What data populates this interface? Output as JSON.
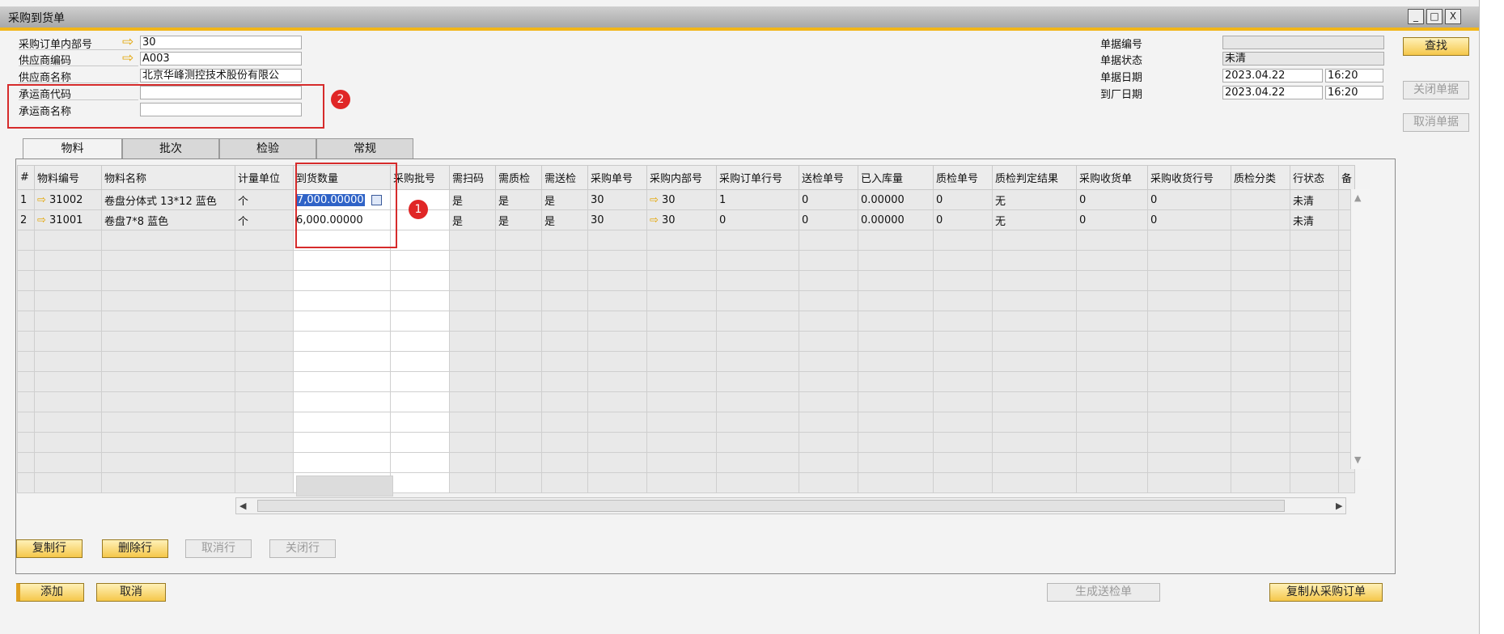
{
  "window": {
    "title": "采购到货单",
    "controls": [
      "_",
      "□",
      "X"
    ]
  },
  "header_left": {
    "po_internal_no": {
      "label": "采购订单内部号",
      "value": "30"
    },
    "vendor_code": {
      "label": "供应商编码",
      "value": "A003"
    },
    "vendor_name": {
      "label": "供应商名称",
      "value": "北京华峰测控技术股份有限公"
    },
    "carrier_code": {
      "label": "承运商代码",
      "value": ""
    },
    "carrier_name": {
      "label": "承运商名称",
      "value": ""
    }
  },
  "header_right": {
    "doc_no": {
      "label": "单据编号",
      "value": ""
    },
    "doc_status": {
      "label": "单据状态",
      "value": "未清"
    },
    "doc_date": {
      "label": "单据日期",
      "value": "2023.04.22",
      "time": "16:20"
    },
    "arrival_date": {
      "label": "到厂日期",
      "value": "2023.04.22",
      "time": "16:20"
    }
  },
  "side_buttons": {
    "find": "查找",
    "close_doc": "关闭单据",
    "cancel_doc": "取消单据"
  },
  "tabs": [
    {
      "label": "物料"
    },
    {
      "label": "批次"
    },
    {
      "label": "检验"
    },
    {
      "label": "常规"
    }
  ],
  "table": {
    "columns": [
      "#",
      "物料编号",
      "物料名称",
      "计量单位",
      "到货数量",
      "采购批号",
      "需扫码",
      "需质检",
      "需送检",
      "采购单号",
      "采购内部号",
      "采购订单行号",
      "送检单号",
      "已入库量",
      "质检单号",
      "质检判定结果",
      "采购收货单",
      "采购收货行号",
      "质检分类",
      "行状态",
      "备"
    ],
    "rows": [
      [
        "1",
        "31002",
        "卷盘分体式 13*12 蓝色",
        "个",
        "7,000.00000",
        "",
        "是",
        "是",
        "是",
        "30",
        "30",
        "1",
        "0",
        "0.00000",
        "0",
        "无",
        "0",
        "0",
        "",
        "未清",
        ""
      ],
      [
        "2",
        "31001",
        "卷盘7*8 蓝色",
        "个",
        "6,000.00000",
        "",
        "是",
        "是",
        "是",
        "30",
        "30",
        "0",
        "0",
        "0.00000",
        "0",
        "无",
        "0",
        "0",
        "",
        "未清",
        ""
      ]
    ]
  },
  "annotations": {
    "badge1": "1",
    "badge2": "2"
  },
  "row_buttons": {
    "copy_row": "复制行",
    "delete_row": "删除行",
    "cancel_row": "取消行",
    "close_row": "关闭行"
  },
  "footer_buttons": {
    "add": "添加",
    "cancel": "取消",
    "gen_inspection": "生成送检单",
    "copy_from_po": "复制从采购订单"
  },
  "colors": {
    "accent": "#f2b619",
    "annotation_red": "#d62b2b",
    "selection": "#2f63c7"
  }
}
